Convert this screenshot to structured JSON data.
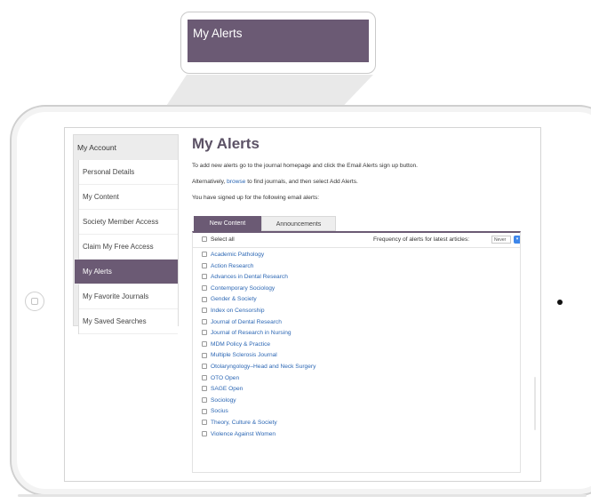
{
  "callout": {
    "label": "My Alerts"
  },
  "sidebar": {
    "title": "My Account",
    "items": [
      {
        "label": "Personal Details",
        "active": false
      },
      {
        "label": "My Content",
        "active": false
      },
      {
        "label": "Society Member Access",
        "active": false
      },
      {
        "label": "Claim My Free Access",
        "active": false
      },
      {
        "label": "My Alerts",
        "active": true
      },
      {
        "label": "My Favorite Journals",
        "active": false
      },
      {
        "label": "My Saved Searches",
        "active": false
      }
    ]
  },
  "main": {
    "title": "My Alerts",
    "intro_1": "To add new alerts go to the journal homepage and click the Email Alerts sign up button.",
    "intro_2_before": "Alternatively, ",
    "intro_2_link": "browse",
    "intro_2_after": " to find journals, and then select Add Alerts.",
    "intro_3": "You have signed up for the following email alerts:",
    "tabs": [
      {
        "label": "New Content",
        "active": true
      },
      {
        "label": "Announcements",
        "active": false
      }
    ],
    "select_all_label": "Select all",
    "frequency_label": "Frequency of alerts for latest articles:",
    "frequency_value": "Never",
    "journals": [
      "Academic Pathology",
      "Action Research",
      "Advances in Dental Research",
      "Contemporary Sociology",
      "Gender & Society",
      "Index on Censorship",
      "Journal of Dental Research",
      "Journal of Research in Nursing",
      "MDM Policy & Practice",
      "Multiple Sclerosis Journal",
      "Otolaryngology–Head and Neck Surgery",
      "OTO Open",
      "SAGE Open",
      "Sociology",
      "Socius",
      "Theory, Culture & Society",
      "Violence Against Women"
    ]
  },
  "colors": {
    "accent": "#6b5a74",
    "link": "#2c67b4",
    "select_arrow": "#3d86ea"
  }
}
